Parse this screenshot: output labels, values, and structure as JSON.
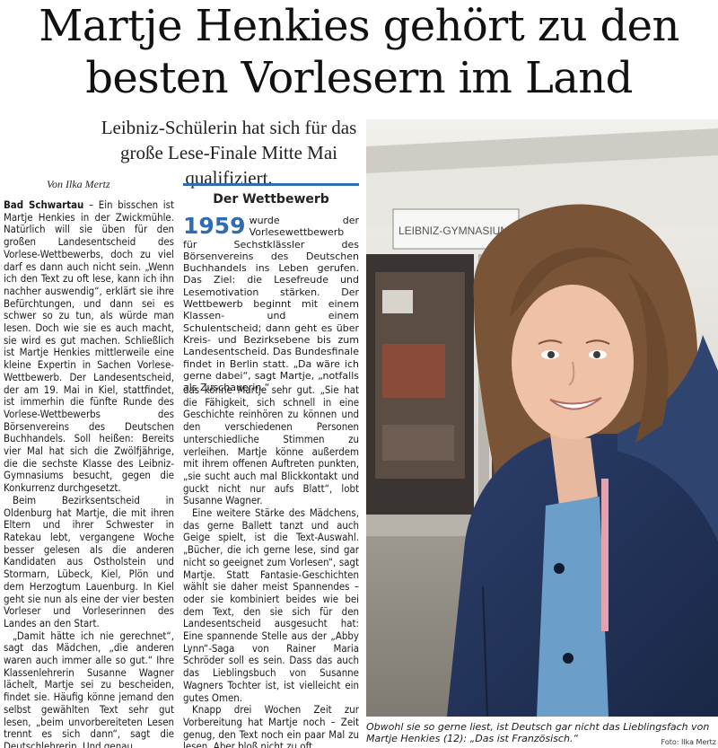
{
  "article": {
    "headline_line1": "Martje Henkies gehört zu den",
    "headline_line2": "besten Vorlesern im Land",
    "subtitle_line1": "Leibniz-Schülerin hat sich für das",
    "subtitle_line2": "große Lese-Finale Mitte Mai qualifiziert.",
    "byline": "Von Ilka Mertz",
    "placeline": "Bad Schwartau",
    "col1_p1": " – Ein bisschen ist Martje Henkies in der Zwickmühle. Natürlich will sie üben für den großen Landesentscheid des Vorlese-Wettbewerbs, doch zu viel darf es dann auch nicht sein. „Wenn ich den Text zu oft lese, kann ich ihn nachher auswendig“, erklärt sie ihre Befürchtungen, und dann sei es schwer so zu tun, als würde man lesen. Doch wie sie es auch macht, sie wird es gut machen. Schließlich ist Martje Henkies mittlerweile eine kleine Expertin in Sachen Vorlese-Wettbewerb. Der Landesentscheid, der am 19. Mai in Kiel, stattfindet, ist immerhin die fünfte Runde des Vorlese-Wettbewerbs des Börsenvereins des Deutschen Buchhandels. Soll heißen: Bereits vier Mal hat sich die Zwölfjährige, die die sechste Klasse des Leibniz-Gymnasiums besucht, gegen die Konkurrenz durchgesetzt.",
    "col1_p2": "Beim Bezirksentscheid in Oldenburg hat Martje, die mit ihren Eltern und ihrer Schwester in Ratekau lebt, vergangene Woche besser gelesen als die anderen Kandidaten aus Ostholstein und Stormarn, Lübeck, Kiel, Plön und dem Herzogtum Lauenburg. In Kiel geht sie nun als eine der vier besten Vorleser und Vorleserinnen des Landes an den Start.",
    "col1_p3": "„Damit hätte ich nie gerechnet“, sagt das Mädchen, „die anderen waren auch immer alle so gut.“ Ihre Klassenlehrerin Susanne Wagner lächelt, Martje sei zu bescheiden, findet sie. Häufig könne jemand den selbst gewählten Text sehr gut lesen, „beim unvorbereiteten Lesen trennt es sich dann“, sagt die Deutschlehrerin. Und genau",
    "col2_p1": "das könne Martje sehr gut. „Sie hat die Fähigkeit, sich schnell in eine Geschichte reinhören zu können und den verschiedenen Personen unterschiedliche Stimmen zu verleihen. Martje könne außerdem mit ihrem offenen Auftreten punkten, „sie sucht auch mal Blickkontakt und guckt nicht nur aufs Blatt“, lobt Susanne Wagner.",
    "col2_p2": "Eine weitere Stärke des Mädchens, das gerne Ballett tanzt und auch Geige spielt, ist die Text-Auswahl. „Bücher, die ich gerne lese, sind gar nicht so geeignet zum Vorlesen“, sagt Martje. Statt Fantasie-Geschichten wählt sie daher meist Spannendes – oder sie kombiniert beides wie bei dem Text, den sie sich für den Landesentscheid ausgesucht hat: Eine spannende Stelle aus der „Abby Lynn“-Saga von Rainer Maria Schröder soll es sein. Dass das auch das Lieblingsbuch von Susanne Wagners Tochter ist, ist vielleicht ein gutes Omen.",
    "col2_p3": "Knapp drei Wochen Zeit zur Vorbereitung hat Martje noch – Zeit genug, den Text noch ein paar Mal zu lesen. Aber bloß nicht zu oft . . ."
  },
  "infobox": {
    "title": "Der Wettbewerb",
    "year": "1959",
    "text": "wurde der Vorlesewettbewerb für Sechstklässler des Börsenvereins des Deutschen Buchhandels ins Leben gerufen. Das Ziel: die Lesefreude und Lesemotivation stärken. Der Wettbewerb beginnt mit einem Klassen- und einem Schulentscheid; dann geht es über Kreis- und Bezirksebene bis zum Landesentscheid. Das Bundesfinale findet in Berlin statt. „Da wäre ich gerne dabei“, sagt Martje, „notfalls als Zuschauerin.“"
  },
  "photo": {
    "sign_text": "LEIBNIZ-GYMNASIUM",
    "caption_line1": "Obwohl sie so gerne liest, ist Deutsch gar nicht das Lieblingsfach von",
    "caption_line2": "Martje Henkies (12): „Das ist Französisch.“",
    "credit": "Foto: Ilka Mertz"
  }
}
